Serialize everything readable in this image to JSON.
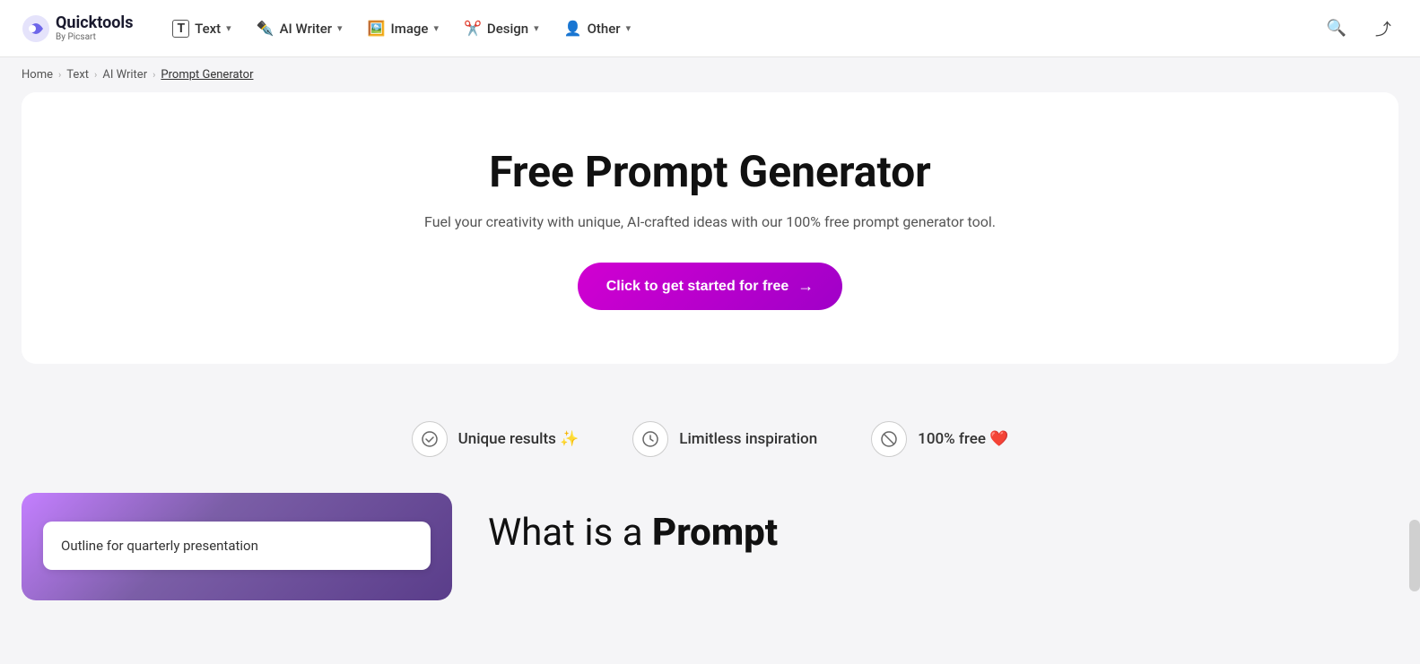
{
  "brand": {
    "logo_text": "Quicktools",
    "logo_sub": "By Picsart",
    "logo_icon": "🔵"
  },
  "navbar": {
    "items": [
      {
        "id": "text",
        "icon": "T",
        "label": "Text",
        "icon_type": "bracket"
      },
      {
        "id": "ai-writer",
        "icon": "✏️",
        "label": "AI Writer",
        "icon_type": "pen"
      },
      {
        "id": "image",
        "icon": "🖼️",
        "label": "Image",
        "icon_type": "image"
      },
      {
        "id": "design",
        "icon": "✂️",
        "label": "Design",
        "icon_type": "scissors"
      },
      {
        "id": "other",
        "icon": "👤",
        "label": "Other",
        "icon_type": "person"
      }
    ],
    "search_aria": "Search",
    "share_aria": "Share"
  },
  "breadcrumb": {
    "items": [
      {
        "label": "Home",
        "active": false
      },
      {
        "label": "Text",
        "active": false
      },
      {
        "label": "AI Writer",
        "active": false
      },
      {
        "label": "Prompt Generator",
        "active": true
      }
    ]
  },
  "hero": {
    "title": "Free Prompt Generator",
    "subtitle": "Fuel your creativity with unique, AI-crafted ideas with our 100% free prompt generator tool.",
    "cta_label": "Click to get started for free",
    "cta_arrow": "→"
  },
  "features": [
    {
      "id": "unique-results",
      "icon": "☑",
      "label": "Unique results ✨"
    },
    {
      "id": "limitless-inspiration",
      "icon": "⏱",
      "label": "Limitless inspiration"
    },
    {
      "id": "free",
      "icon": "⊘",
      "label": "100% free ❤️"
    }
  ],
  "bottom": {
    "input_value": "Outline for quarterly presentation",
    "what_is_text_plain": "What is a ",
    "what_is_text_bold": "Prompt"
  }
}
